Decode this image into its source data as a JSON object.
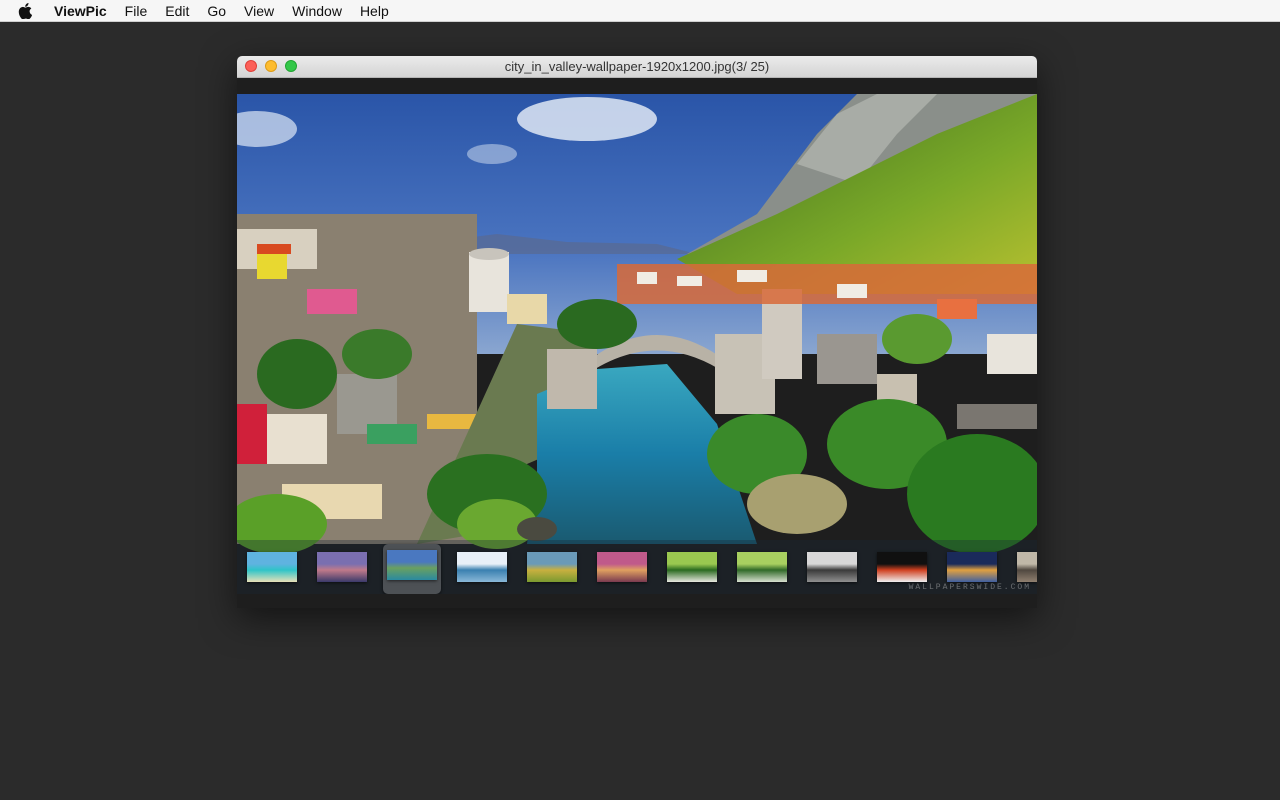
{
  "menubar": {
    "app_name": "ViewPic",
    "items": [
      "File",
      "Edit",
      "Go",
      "View",
      "Window",
      "Help"
    ]
  },
  "window": {
    "title": "city_in_valley-wallpaper-1920x1200.jpg(3/ 25)"
  },
  "photo": {
    "watermark": "WALLPAPERSWIDE.COM"
  },
  "thumbnails": {
    "selected_index": 2,
    "items": [
      {
        "name": "thumb-tropical-beach",
        "colors": [
          "#5fb3e0",
          "#2fc4c8",
          "#e8e0b8"
        ]
      },
      {
        "name": "thumb-city-sunset",
        "colors": [
          "#7a6fb0",
          "#c07a8a",
          "#3a3a6a"
        ]
      },
      {
        "name": "thumb-city-in-valley",
        "colors": [
          "#4a78c0",
          "#6aa060",
          "#2a8aa0"
        ]
      },
      {
        "name": "thumb-aerial-bridge",
        "colors": [
          "#e8f0f8",
          "#3a80b0",
          "#8ab8d8"
        ]
      },
      {
        "name": "thumb-golden-field",
        "colors": [
          "#6a9ab8",
          "#c8b040",
          "#7a9a30"
        ]
      },
      {
        "name": "thumb-flower-street",
        "colors": [
          "#c05a8a",
          "#e0a060",
          "#7a3a50"
        ]
      },
      {
        "name": "thumb-green-road-1",
        "colors": [
          "#9ac850",
          "#2a6a20",
          "#e8e8e0"
        ]
      },
      {
        "name": "thumb-green-road-2",
        "colors": [
          "#a8d060",
          "#306a28",
          "#d8e0d0"
        ]
      },
      {
        "name": "thumb-skyscrapers",
        "colors": [
          "#d8d8d8",
          "#3a3a3a",
          "#909090"
        ]
      },
      {
        "name": "thumb-night-car",
        "colors": [
          "#101010",
          "#d04020",
          "#f0f0f0"
        ]
      },
      {
        "name": "thumb-night-city",
        "colors": [
          "#1a2a5a",
          "#e0a040",
          "#4060a0"
        ]
      },
      {
        "name": "thumb-partial",
        "colors": [
          "#c0b8a8",
          "#504840",
          "#908070"
        ]
      }
    ]
  },
  "colors": {
    "desktop": "#2b2b2b",
    "close": "#fc5f57",
    "minimize": "#fdbc2e",
    "maximize": "#33c748"
  }
}
